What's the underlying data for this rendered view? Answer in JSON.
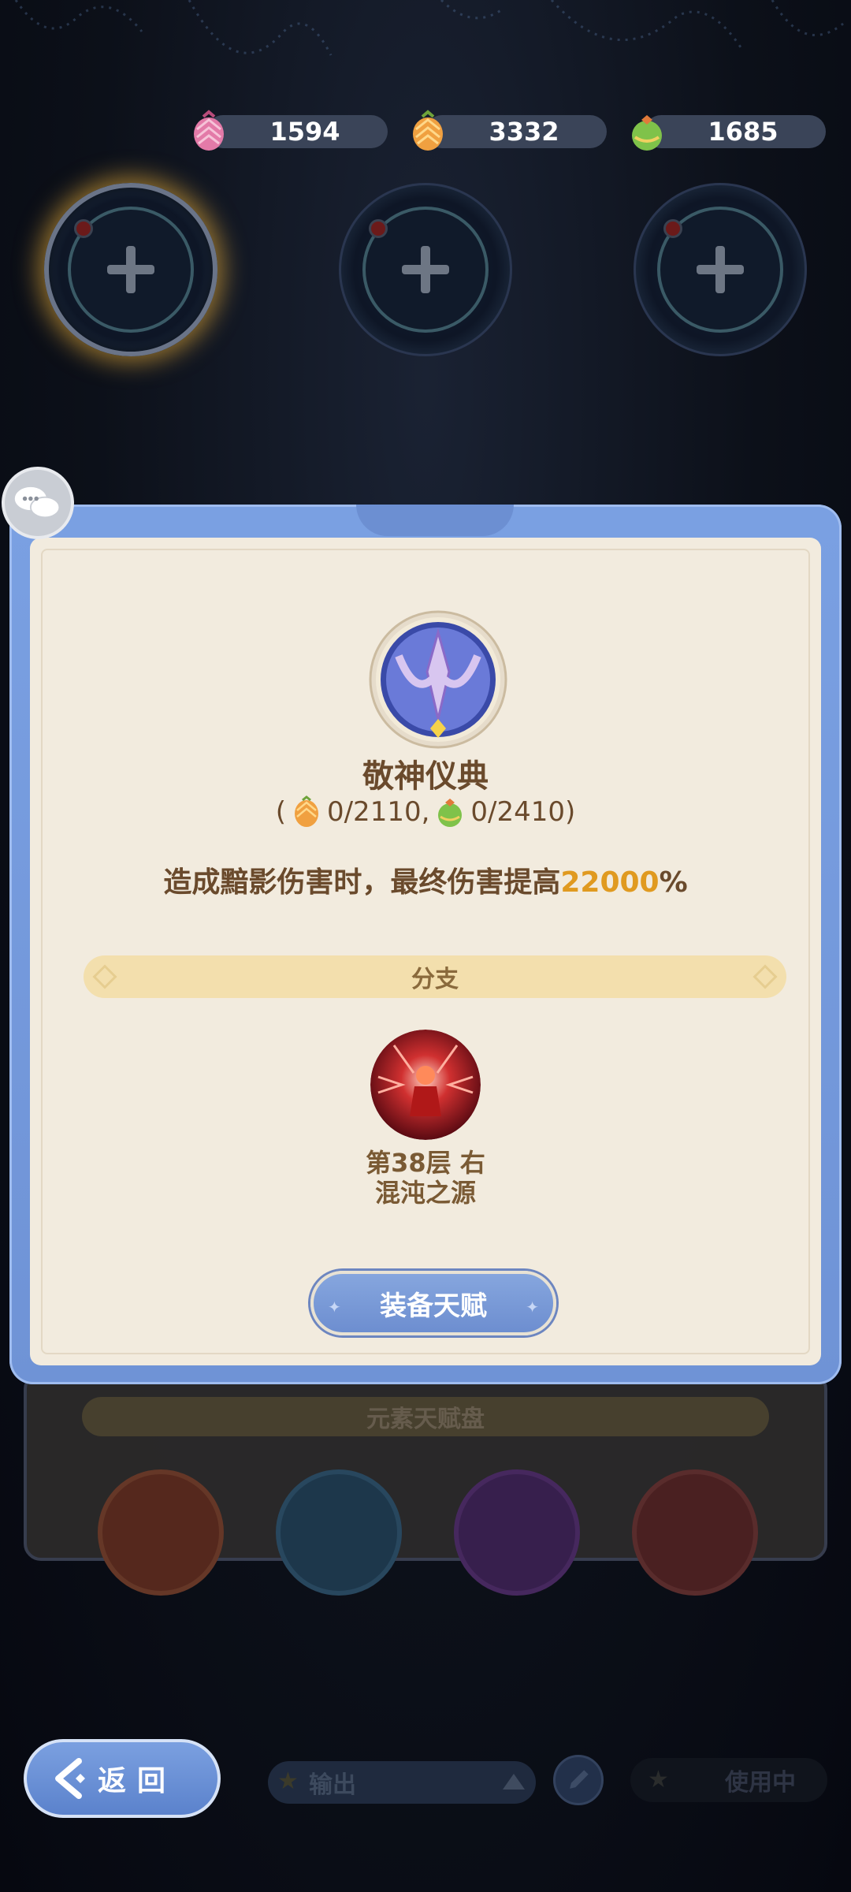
{
  "resources": [
    {
      "name": "pink-gem",
      "value": "1594",
      "color": "#e37aa8"
    },
    {
      "name": "orange-gem",
      "value": "3332",
      "color": "#f0a040"
    },
    {
      "name": "green-gem",
      "value": "1685",
      "color": "#7fc24a"
    }
  ],
  "slots": [
    {
      "state": "active"
    },
    {
      "state": "empty"
    },
    {
      "state": "empty"
    }
  ],
  "modal": {
    "title": "敬神仪典",
    "cost_open": "(",
    "cost_orange": "0/2110",
    "cost_sep": ",",
    "cost_green": "0/2410",
    "cost_close": ")",
    "desc_prefix": "造成黯影伤害时，最终伤害提高",
    "desc_value": "22000",
    "desc_suffix": "%",
    "branch_label": "分支",
    "boss_line1": "第38层  右",
    "boss_line2": "混沌之源",
    "equip_label": "装备天赋"
  },
  "under_panel": {
    "strip_label": "元素天赋盘"
  },
  "bottom": {
    "back_label": "返回",
    "dropdown_label": "输出",
    "inuse_label": "使用中"
  },
  "colors": {
    "accent": "#e09a20",
    "modal_blue": "#7aa0e2",
    "parchment": "#f2ebde",
    "text_brown": "#6a4a2c"
  }
}
